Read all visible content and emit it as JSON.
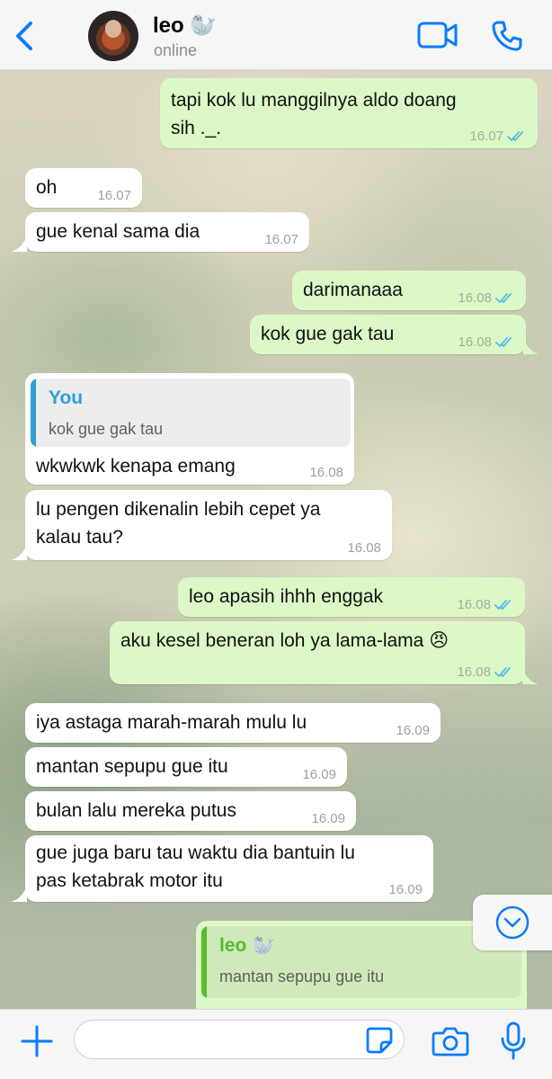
{
  "header": {
    "contact_name": "leo 🦭",
    "status": "online"
  },
  "colors": {
    "accent": "#0a7bff",
    "incoming_bubble": "#ffffff",
    "outgoing_bubble": "#dcf8c6",
    "read_ticks": "#53bdeb",
    "quote_you": "#2e9fd8",
    "quote_leo": "#5cba31"
  },
  "messages": [
    {
      "dir": "out",
      "text": "tapi kok lu manggilnya aldo doang\nsih ._.",
      "time": "16.07",
      "read": true
    },
    {
      "dir": "in",
      "text": "oh",
      "time": "16.07"
    },
    {
      "dir": "in",
      "text": "gue kenal sama dia",
      "time": "16.07"
    },
    {
      "dir": "out",
      "text": "darimanaaa",
      "time": "16.08",
      "read": true
    },
    {
      "dir": "out",
      "text": "kok gue gak tau",
      "time": "16.08",
      "read": true
    },
    {
      "dir": "in",
      "quote": {
        "author": "You",
        "text": "kok gue gak tau"
      },
      "text": "wkwkwk kenapa emang",
      "time": "16.08"
    },
    {
      "dir": "in",
      "text": "lu pengen dikenalin lebih cepet ya\nkalau tau?",
      "time": "16.08"
    },
    {
      "dir": "out",
      "text": "leo apasih ihhh enggak",
      "time": "16.08",
      "read": true
    },
    {
      "dir": "out",
      "text": "aku kesel beneran loh ya lama-lama 😠",
      "time": "16.08",
      "read": true
    },
    {
      "dir": "in",
      "text": "iya astaga marah-marah mulu lu",
      "time": "16.09"
    },
    {
      "dir": "in",
      "text": "mantan sepupu gue itu",
      "time": "16.09"
    },
    {
      "dir": "in",
      "text": "bulan lalu mereka putus",
      "time": "16.09"
    },
    {
      "dir": "in",
      "text": "gue juga baru tau waktu dia bantuin lu\npas ketabrak motor itu",
      "time": "16.09"
    },
    {
      "dir": "out",
      "quote": {
        "author": "leo 🦭",
        "text": "mantan sepupu gue itu"
      },
      "text": "",
      "time": ""
    }
  ],
  "input": {
    "placeholder": "",
    "value": ""
  },
  "icons": {
    "back": "chevron-left-icon",
    "video": "video-camera-icon",
    "call": "phone-icon",
    "scroll_down": "chevron-down-circle-icon",
    "attach": "plus-icon",
    "sticker": "sticker-icon",
    "camera": "camera-icon",
    "mic": "microphone-icon"
  }
}
